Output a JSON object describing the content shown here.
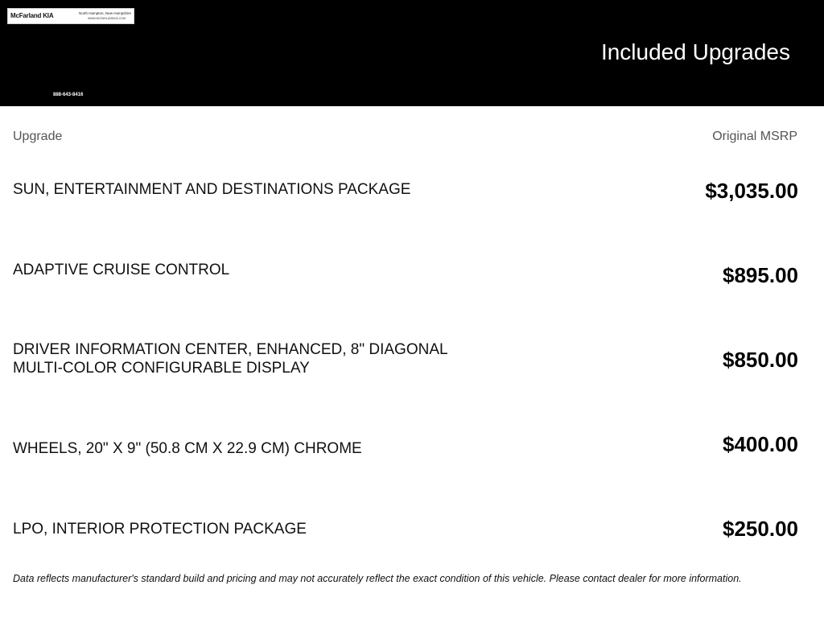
{
  "header": {
    "logo": {
      "name": "McFarland KIA",
      "location": "North Hampton, New Hampshire",
      "website": "WWW.MCFARLANDKIA.COM"
    },
    "phone": "888-643-8416",
    "title": "Included Upgrades",
    "background_color": "#000000"
  },
  "table": {
    "columns": {
      "upgrade": "Upgrade",
      "msrp": "Original MSRP"
    },
    "rows": [
      {
        "name": "SUN, ENTERTAINMENT AND DESTINATIONS PACKAGE",
        "price": "$3,035.00"
      },
      {
        "name": "ADAPTIVE CRUISE CONTROL",
        "price": "$895.00"
      },
      {
        "name": "DRIVER INFORMATION CENTER, ENHANCED, 8\" DIAGONAL MULTI-COLOR CONFIGURABLE DISPLAY",
        "price": "$850.00"
      },
      {
        "name": "WHEELS, 20\" X 9\" (50.8 CM X 22.9 CM) CHROME",
        "price": "$400.00"
      },
      {
        "name": "LPO, INTERIOR PROTECTION PACKAGE",
        "price": "$250.00"
      }
    ]
  },
  "disclaimer": "Data reflects manufacturer's standard build and pricing and may not accurately reflect the exact condition of this vehicle. Please contact dealer for more information."
}
